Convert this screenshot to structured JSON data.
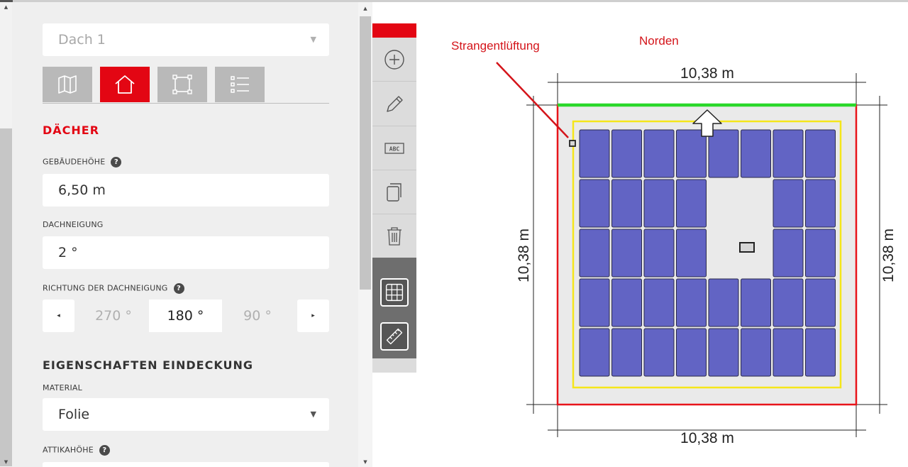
{
  "panel": {
    "roof_select": {
      "value": "Dach 1"
    },
    "tabs": [
      {
        "name": "map-icon",
        "active": false
      },
      {
        "name": "roof-icon",
        "active": true
      },
      {
        "name": "area-icon",
        "active": false
      },
      {
        "name": "list-icon",
        "active": false
      }
    ],
    "section_roofs": "DÄCHER",
    "building_height": {
      "label": "GEBÄUDEHÖHE",
      "value": "6,50 m",
      "help": "?"
    },
    "roof_pitch": {
      "label": "DACHNEIGUNG",
      "value": "2 °"
    },
    "pitch_direction": {
      "label": "RICHTUNG DER DACHNEIGUNG",
      "help": "?",
      "prev_arrow": "◂",
      "next_arrow": "▸",
      "options": [
        "270 °",
        "180 °",
        "90 °"
      ],
      "selected": "180 °"
    },
    "section_covering": "EIGENSCHAFTEN EINDECKUNG",
    "material": {
      "label": "MATERIAL",
      "value": "Folie"
    },
    "parapet_height": {
      "label": "ATTIKAHÖHE",
      "help": "?"
    }
  },
  "tools": [
    "add-icon",
    "pencil-icon",
    "text-label-icon",
    "copy-icon",
    "trash-icon",
    "grid-icon",
    "ruler-icon"
  ],
  "tool_text_label": "ABC",
  "canvas": {
    "vent_label": "Strangentlüftung",
    "north_label": "Norden",
    "dim_top": "10,38 m",
    "dim_bottom": "10,38 m",
    "dim_left": "10,38 m",
    "dim_right": "10,38 m"
  },
  "layout": {
    "panel_rows": 5,
    "panel_cols": 8,
    "gap_cells": [
      [
        1,
        4
      ],
      [
        1,
        5
      ],
      [
        2,
        4
      ],
      [
        2,
        5
      ]
    ]
  },
  "colors": {
    "accent": "#e30613",
    "panel_fill": "#6264c4",
    "roof_edge": "#e8141a",
    "setback": "#f5e61a",
    "north_edge": "#2ad82a",
    "annotation": "#d4141a"
  }
}
